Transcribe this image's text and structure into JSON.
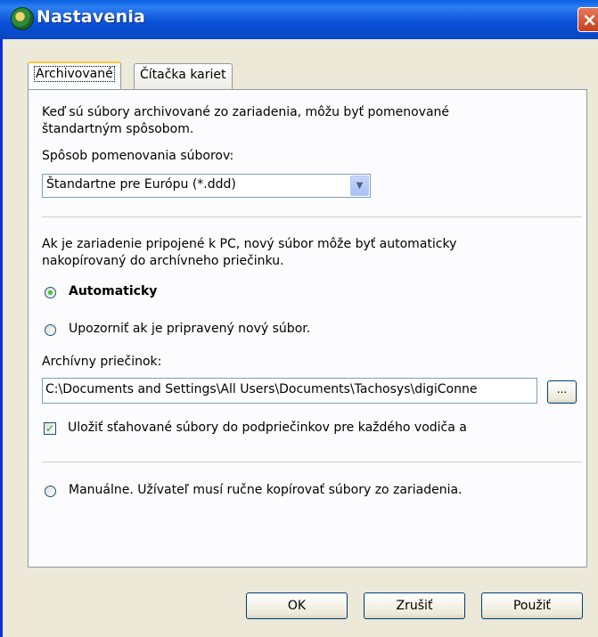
{
  "window": {
    "title": "Nastavenia",
    "close_glyph": "×"
  },
  "tabs": [
    {
      "label": "Archivované",
      "active": true
    },
    {
      "label": "Čítačka kariet",
      "active": false
    }
  ],
  "archive": {
    "intro_line1": "Keď sú súbory archivované zo zariadenia, môžu byť pomenované",
    "intro_line2": "štandartným spôsobom.",
    "naming_label": "Spôsob pomenovania súborov:",
    "naming_value": "Štandartne pre Európu (*.ddd)",
    "connect_line1": "Ak je zariadenie pripojené k PC, nový súbor môže byť automaticky",
    "connect_line2": "nakopírovaný do archívneho priečinku.",
    "radio_auto": "Automaticky",
    "radio_notify": "Upozorniť ak je pripravený nový súbor.",
    "folder_label": "Archívny priečinok:",
    "folder_value": "C:\\Documents and Settings\\All Users\\Documents\\Tachosys\\digiConne",
    "browse_label": "...",
    "subfolder_checkbox": "Uložiť sťahované súbory do podpriečinkov pre každého vodiča a",
    "radio_manual": "Manuálne. Užívateľ musí ručne kopírovať súbory zo zariadenia."
  },
  "buttons": {
    "ok": "OK",
    "cancel": "Zrušiť",
    "apply": "Použiť"
  },
  "colors": {
    "titlebar": "#0b52d9",
    "dialog_bg": "#ece9d8",
    "panel_bg": "#fcfcfe",
    "radio_dot": "#21a121"
  }
}
